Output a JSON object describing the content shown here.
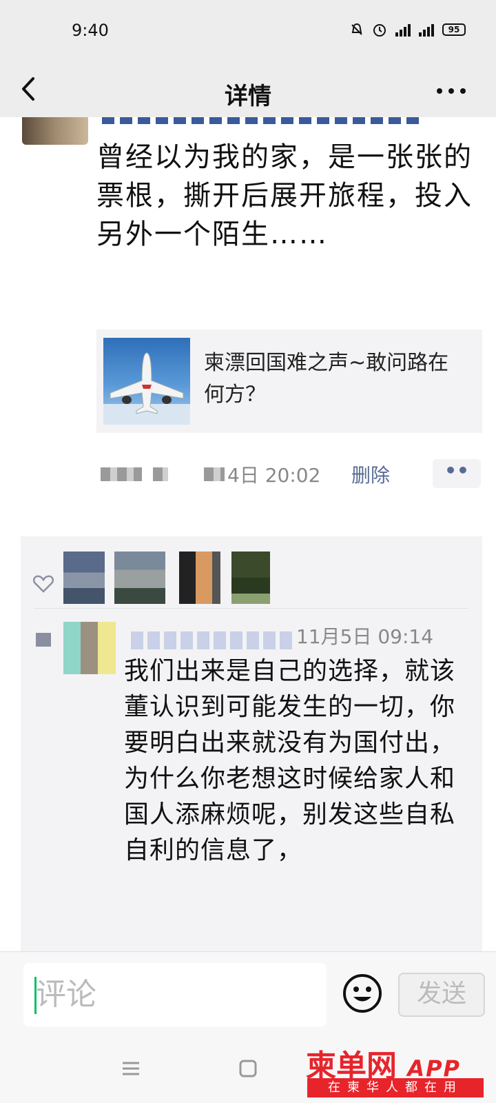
{
  "status_bar": {
    "time": "9:40",
    "battery": "95",
    "network": "4G"
  },
  "nav": {
    "title": "详情",
    "back_icon": "chevron-left-icon",
    "more_icon": "more-dots-icon"
  },
  "post": {
    "text": "曾经以为我的家，是一张张的票根，撕开后展开旅程，投入另外一个陌生……",
    "link_card": {
      "title": "柬漂回国难之声~敢问路在何方？",
      "thumbnail": "airplane-image"
    },
    "timestamp": "4日 20:02",
    "delete_label": "删除",
    "action_label": "••"
  },
  "likes": {
    "icon": "heart-icon"
  },
  "comment": {
    "time": "11月5日 09:14",
    "text": "我们出来是自己的选择，就该董认识到可能发生的一切，你要明白出来就没有为国付出，为什么你老想这时候给家人和国人添麻烦呢，别发这些自私自利的信息了，"
  },
  "input_bar": {
    "placeholder": "评论",
    "emoji_icon": "smiley-icon",
    "send_label": "发送"
  },
  "system_nav": {
    "menu_icon": "menu-lines-icon",
    "home_icon": "home-square-icon",
    "back_icon": "back-triangle-icon"
  },
  "watermark": {
    "brand": "柬单网",
    "app": "APP",
    "slogan": "在柬华人都在用"
  },
  "colors": {
    "accent_green": "#07c160",
    "link_blue": "#576b95",
    "watermark_red": "#e8242b"
  }
}
